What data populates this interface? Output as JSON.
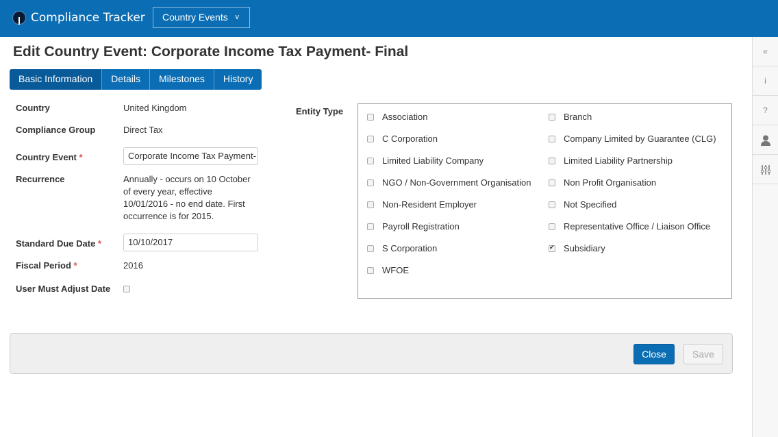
{
  "app": {
    "title": "Compliance Tracker",
    "menu": "Country Events",
    "menu_icon": "v"
  },
  "page": {
    "title": "Edit Country Event: Corporate Income Tax Payment- Final"
  },
  "tabs": [
    "Basic Information",
    "Details",
    "Milestones",
    "History"
  ],
  "form": {
    "country_label": "Country",
    "country": "United Kingdom",
    "group_label": "Compliance Group",
    "group": "Direct Tax",
    "event_label": "Country Event",
    "event": "Corporate Income Tax Payment- Final",
    "recurrence_label": "Recurrence",
    "recurrence": "Annually - occurs on 10 October of every year, effective 10/01/2016 - no end date. First occurrence is for 2015.",
    "due_label": "Standard Due Date",
    "due": "10/10/2017",
    "fiscal_label": "Fiscal Period",
    "fiscal": "2016",
    "adjust_label": "User Must Adjust Date",
    "required_mark": "*"
  },
  "entity": {
    "label": "Entity Type",
    "items": [
      {
        "name": "Association",
        "checked": false
      },
      {
        "name": "Branch",
        "checked": false
      },
      {
        "name": "C Corporation",
        "checked": false
      },
      {
        "name": "Company Limited by Guarantee (CLG)",
        "checked": false
      },
      {
        "name": "Limited Liability Company",
        "checked": false
      },
      {
        "name": "Limited Liability Partnership",
        "checked": false
      },
      {
        "name": "NGO / Non-Government Organisation",
        "checked": false
      },
      {
        "name": "Non Profit Organisation",
        "checked": false
      },
      {
        "name": "Non-Resident Employer",
        "checked": false
      },
      {
        "name": "Not Specified",
        "checked": false
      },
      {
        "name": "Payroll Registration",
        "checked": false
      },
      {
        "name": "Representative Office / Liaison Office",
        "checked": false
      },
      {
        "name": "S Corporation",
        "checked": false
      },
      {
        "name": "Subsidiary",
        "checked": true
      },
      {
        "name": "WFOE",
        "checked": false
      }
    ]
  },
  "footer": {
    "close": "Close",
    "save": "Save"
  },
  "sidebar": {
    "collapse": "«",
    "info": "i",
    "help": "?"
  },
  "colors": {
    "brand": "#0b6db3",
    "tab_active": "#095a99"
  }
}
